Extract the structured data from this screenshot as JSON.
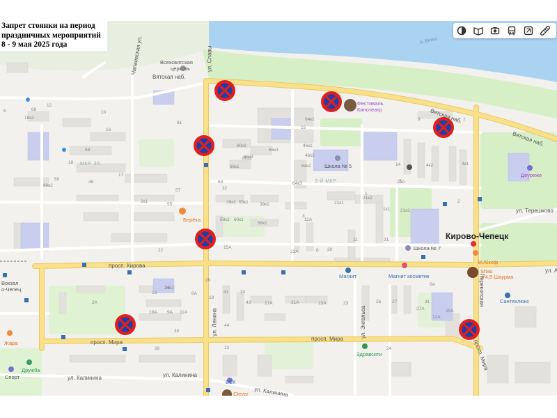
{
  "notice": {
    "line1": "Запрет стоянки на период",
    "line2": "праздничных мероприятий",
    "line3": "8 - 9 мая 2025 года"
  },
  "toolbar": {
    "buttons": [
      "layers-icon",
      "panorama-icon",
      "camera-icon",
      "transport-icon",
      "traffic-icon",
      "ruler-icon"
    ]
  },
  "colors": {
    "water": "#aad3f2",
    "park": "#d6efc6",
    "road_major": "#fbe08a",
    "road_minor": "#ffffff",
    "sign_red": "#e02020",
    "sign_blue": "#1e3fa8"
  },
  "city": "Кирово-Чепецк",
  "streets": {
    "vyatskaya_nab_left": "Вятская наб.",
    "vyatskaya_nab_right": "Вятская наб.",
    "vyatskaya_nab_far": "Вятская наб.",
    "slavy": "ул. Славы",
    "chapaeva": "Чапаевская ул.",
    "kirova": "просп. Кирова",
    "mira_left": "просп. Мира",
    "mira_center": "просп. Мира",
    "mira_right": "просп. Мира",
    "lenina": "ул. Ленина",
    "engelsa": "ул. Энгельса",
    "perekopskaya": "Перекопская",
    "tereshkovoy": "ул. Терешково",
    "kalinina_left": "ул. Калинина",
    "kalinina_center": "ул. Калинина",
    "kalinina_right": "ул. Калинина",
    "kirova_right": "ул. А"
  },
  "districts": {
    "mkr3a": "МКР. 3А",
    "mkr3": "3-Й МКР."
  },
  "water": {
    "river": "р. Вятка"
  },
  "pois": {
    "church_l1": "Всехсвятская",
    "church_l2": "церковь",
    "festival_l1": "Фестиваль",
    "festival_l2": "Кинотеатр",
    "school5": "Школа № 5",
    "school7": "Школа № 7",
    "bereka": "Берёка",
    "magnit": "Магнит",
    "magnit_cosmetic": "Магнит косметик",
    "busfood": "BUSкоф",
    "shau_l1": "Shau",
    "shau_l2": "★4,5 Шаурма",
    "santekhluks": "Сантехлюкс",
    "zdravsiti": "Здравсити",
    "zhara": "Жара",
    "druzhba": "Дружба",
    "sport": "Спорт",
    "vsk": "ВСК",
    "clever": "Clever",
    "deurezhe": "Деуреже",
    "vokzal_l1": "Вокзал",
    "vokzal_l2": "о-Чепец"
  },
  "house_numbers": [
    "18к2",
    "66",
    "6",
    "12",
    "10",
    "16",
    "18",
    "17",
    "59",
    "49",
    "50",
    "55",
    "57",
    "61",
    "66к1",
    "66к2",
    "66к3",
    "80к1",
    "80к2",
    "63",
    "64к1",
    "64к2",
    "64к3",
    "46к1",
    "46к2",
    "4к2",
    "4к1",
    "9",
    "7",
    "5",
    "14",
    "15",
    "2",
    "1",
    "3",
    "8",
    "11А",
    "21к1",
    "21к2",
    "21к3",
    "11",
    "21",
    "23А",
    "21А",
    "32",
    "39к2",
    "39к1",
    "55к1",
    "58к1",
    "58к2",
    "60к1",
    "60к2",
    "24к2",
    "17А",
    "19А",
    "9А",
    "11А",
    "13А",
    "23",
    "25",
    "27",
    "31",
    "33",
    "41",
    "43",
    "35",
    "2А",
    "6А",
    "12А",
    "25А",
    "27А",
    "29",
    "8А",
    "10А",
    "1к1",
    "2к1",
    "22",
    "13",
    "15А",
    "19",
    "20",
    "30",
    "44",
    "12",
    "26",
    "24"
  ]
}
